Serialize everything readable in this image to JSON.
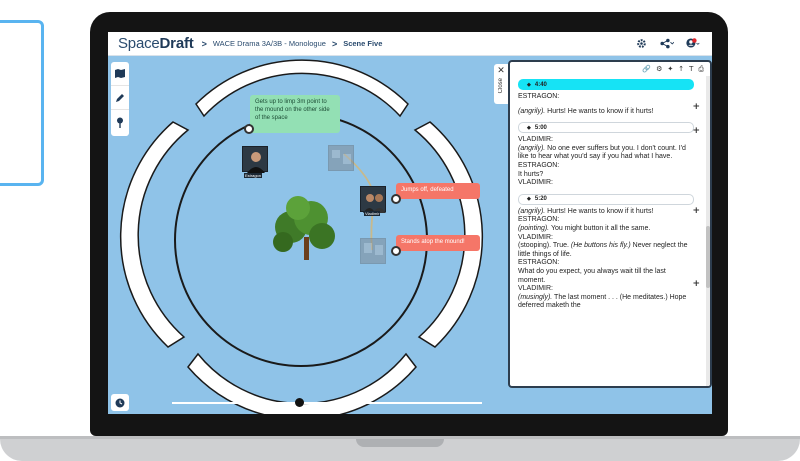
{
  "app": {
    "brand_light": "Space",
    "brand_bold": "Draft"
  },
  "breadcrumb": {
    "sep1": ">",
    "project": "WACE Drama 3A/3B - Monologue",
    "sep2": ">",
    "scene": "Scene Five"
  },
  "topbar_icons": [
    "gear-icon",
    "share-icon",
    "chevron-down-icon",
    "user-avatar-icon"
  ],
  "toolbar": {
    "items": [
      "map-icon",
      "pencil-icon",
      "pin-icon"
    ]
  },
  "clock_icon": "clock-icon",
  "timeline": {
    "position": 0.41
  },
  "stage_notes": {
    "green": "Gets up to limp 3m point to the mound on the other side of the space",
    "red1": "Jumps off, defeated",
    "red2": "Stands atop the mound!"
  },
  "actors": {
    "actor1_label": "Estragon",
    "actor2_label": "Vladimir"
  },
  "close_tab": {
    "label": "Close",
    "icon": "close-icon"
  },
  "panel_icons": [
    "link-icon",
    "settings-icon",
    "pin-icon",
    "arrow-up-icon",
    "text-icon",
    "print-icon"
  ],
  "script": {
    "ts1": "4:40",
    "ts2": "5:00",
    "ts3": "5:20",
    "l1": "ESTRAGON:",
    "l2a": "(angrily).",
    "l2b": " Hurts! He wants to know if it hurts!",
    "l3": "VLADIMIR:",
    "l4a": "(angrily).",
    "l4b": " No one ever suffers but you. I don't count. I'd like to hear what you'd say if you had what I have.",
    "l5": "ESTRAGON:",
    "l6": "It hurts?",
    "l7": "VLADIMIR:",
    "l8a": "(angrily).",
    "l8b": " Hurts! He wants to know if it hurts!",
    "l9": "ESTRAGON:",
    "l10a": "(pointing).",
    "l10b": " You might button it all the same.",
    "l11": "VLADIMIR:",
    "l12a": "(stooping). True. ",
    "l12b": "(He buttons his fly.)",
    "l12c": " Never neglect the little things of life.",
    "l13": "ESTRAGON:",
    "l14": "What do you expect, you always wait till the last moment.",
    "l15": "VLADIMIR:",
    "l16a": "(musingly).",
    "l16b": " The last moment . . . (He meditates.) Hope deferred maketh the"
  },
  "colors": {
    "stage_bg": "#8fc3e8",
    "active_timestamp": "#16e3f5",
    "green_note": "#93e0b4",
    "red_note": "#f57668",
    "brand": "#1f3a58"
  }
}
